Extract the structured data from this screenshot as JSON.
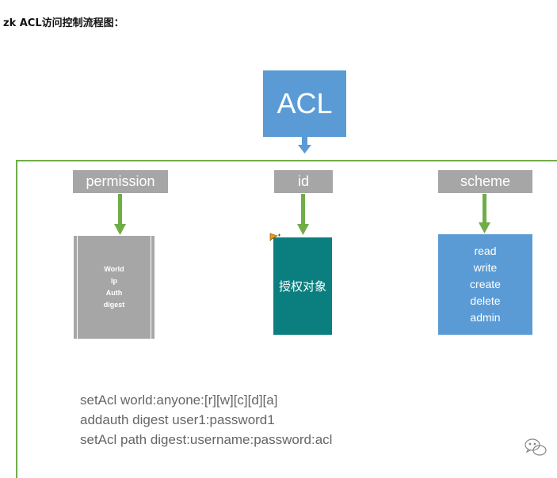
{
  "title": "zk ACL访问控制流程图：",
  "root": {
    "label": "ACL"
  },
  "columns": [
    {
      "header": "permission",
      "items": [
        "World",
        "Ip",
        "Auth",
        "digest"
      ]
    },
    {
      "header": "id",
      "items": [
        "授权对象"
      ]
    },
    {
      "header": "scheme",
      "items": [
        "read",
        "write",
        "create",
        "delete",
        "admin"
      ]
    }
  ],
  "commands": [
    "setAcl world:anyone:[r][w][c][d][a]",
    "addauth digest user1:password1",
    "setAcl path digest:username:password:acl"
  ],
  "colors": {
    "acl_box": "#5b9bd5",
    "label_box": "#a6a6a6",
    "id_box": "#0b7f7f",
    "arrow_green": "#70ad47",
    "scheme_box": "#5b9bd5"
  },
  "icons": {
    "watermark": "wechat-icon",
    "move_cursor": "move-cursor-icon"
  }
}
